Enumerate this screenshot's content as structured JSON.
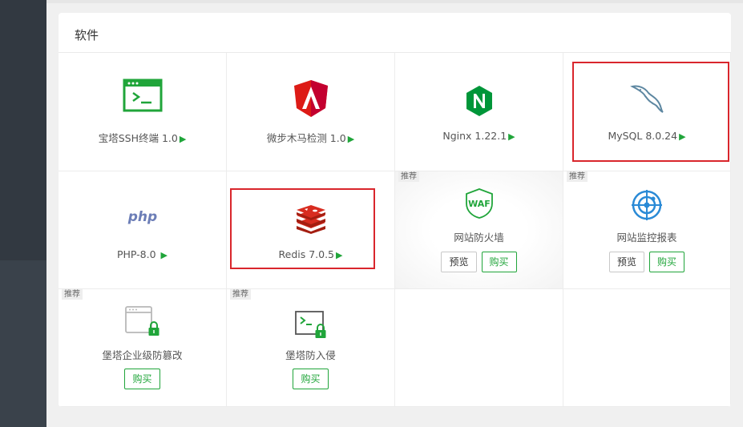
{
  "panel": {
    "title": "软件"
  },
  "software": [
    {
      "name": "宝塔SSH终端 1.0",
      "icon": "terminal-icon"
    },
    {
      "name": "微步木马检测 1.0",
      "icon": "shield-icon"
    },
    {
      "name": "Nginx 1.22.1",
      "icon": "nginx-icon"
    },
    {
      "name": "MySQL 8.0.24",
      "icon": "mysql-dolphin-icon"
    },
    {
      "name": "PHP-8.0 ",
      "icon": "php-icon"
    },
    {
      "name": "Redis 7.0.5",
      "icon": "redis-icon"
    },
    {
      "name": "网站防火墙",
      "icon": "waf-icon",
      "badge": "推荐",
      "preview": "预览",
      "buy": "购买"
    },
    {
      "name": "网站监控报表",
      "icon": "radar-icon",
      "badge": "推荐",
      "preview": "预览",
      "buy": "购买"
    },
    {
      "name": "堡塔企业级防篡改",
      "icon": "tamper-lock-icon",
      "badge": "推荐",
      "buy": "购买"
    },
    {
      "name": "堡塔防入侵",
      "icon": "intrusion-lock-icon",
      "badge": "推荐",
      "buy": "购买"
    }
  ],
  "play_symbol": "▶",
  "colors": {
    "accent": "#20a53a",
    "highlight": "#d9262c",
    "sidebar": "#323941"
  }
}
